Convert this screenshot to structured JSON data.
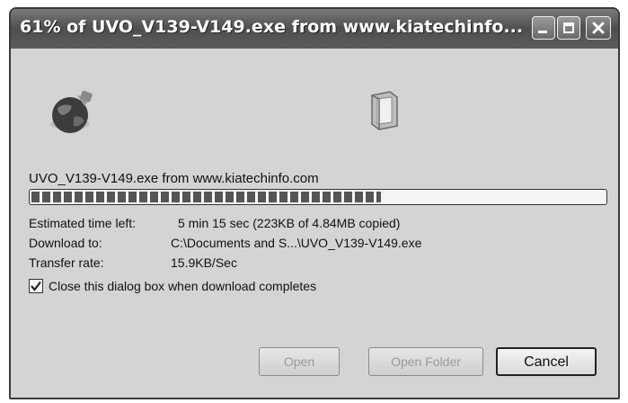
{
  "window": {
    "title": "61% of UVO_V139-V149.exe from www.kiatechinfo...."
  },
  "titlebar_buttons": {
    "minimize_icon": "minimize-icon",
    "maximize_icon": "maximize-icon",
    "close_icon": "close-icon"
  },
  "icons": {
    "globe": "globe-icon",
    "folder": "folder-icon"
  },
  "download": {
    "file_source": "UVO_V139-V149.exe from www.kiatechinfo.com",
    "progress_fraction": 0.61,
    "estimated_label": "Estimated time left:",
    "estimated_value": "5 min 15 sec (223KB of 4.84MB copied)",
    "download_to_label": "Download to:",
    "download_to_value": "C:\\Documents and S...\\UVO_V139-V149.exe",
    "rate_label": "Transfer rate:",
    "rate_value": "15.9KB/Sec"
  },
  "options": {
    "close_when_done_label": "Close this dialog box when download completes",
    "close_when_done_checked": true
  },
  "buttons": {
    "open": "Open",
    "open_folder": "Open Folder",
    "cancel": "Cancel"
  }
}
